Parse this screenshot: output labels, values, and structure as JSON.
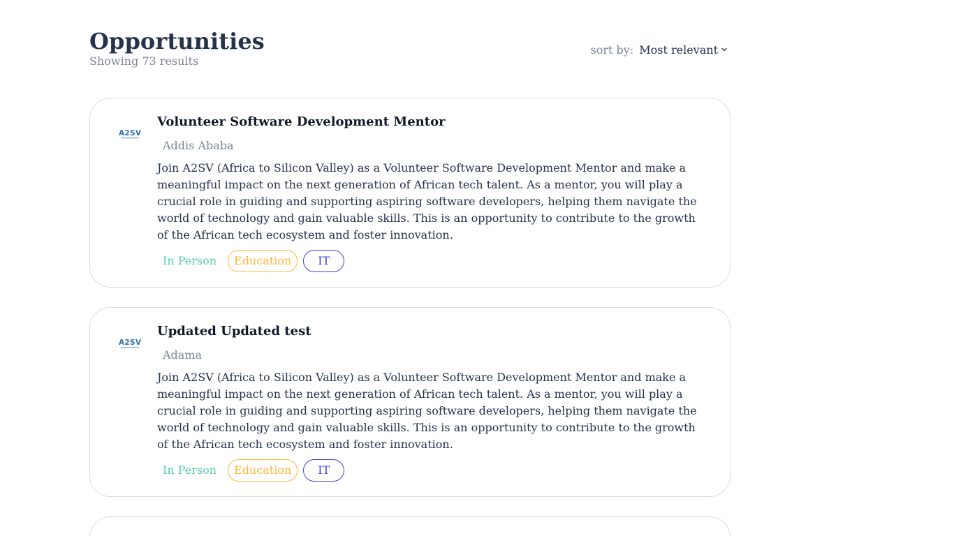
{
  "header": {
    "title": "Opportunities",
    "results": "Showing 73 results",
    "sort_label": "sort by:",
    "sort_value": "Most relevant"
  },
  "cards": [
    {
      "logo_text": "A2SV",
      "title": "Volunteer Software Development Mentor",
      "location": "Addis Ababa",
      "description": "Join A2SV (Africa to Silicon Valley) as a Volunteer Software Development Mentor and make a meaningful impact on the next generation of African tech talent. As a mentor, you will play a crucial role in guiding and supporting aspiring software developers, helping them navigate the world of technology and gain valuable skills. This is an opportunity to contribute to the growth of the African tech ecosystem and foster innovation.",
      "tags": [
        "In Person",
        "Education",
        "IT"
      ]
    },
    {
      "logo_text": "A2SV",
      "title": "Updated Updated test",
      "location": "Adama",
      "description": "Join A2SV (Africa to Silicon Valley) as a Volunteer Software Development Mentor and make a meaningful impact on the next generation of African tech talent. As a mentor, you will play a crucial role in guiding and supporting aspiring software developers, helping them navigate the world of technology and gain valuable skills. This is an opportunity to contribute to the growth of the African tech ecosystem and foster innovation.",
      "tags": [
        "In Person",
        "Education",
        "IT"
      ]
    }
  ],
  "colors": {
    "title": "#25324b",
    "muted": "#7c8493",
    "in_person": "#56cdad",
    "education": "#ffb836",
    "it": "#4640de",
    "card_border": "#d6ddeb"
  },
  "icons": {
    "sort_chevron": "chevron-down-icon",
    "logo": "a2sv-logo"
  }
}
